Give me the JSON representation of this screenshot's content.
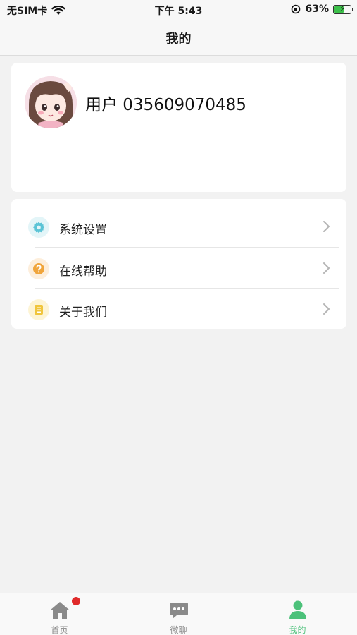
{
  "status_bar": {
    "carrier": "无SIM卡",
    "time": "下午 5:43",
    "battery_percent": "63%",
    "battery_level": 0.63
  },
  "header": {
    "title": "我的"
  },
  "profile": {
    "username": "用户 035609070485"
  },
  "menu": [
    {
      "label": "系统设置",
      "icon": "gear-icon",
      "color": "#5bc4d6",
      "bg": "#e3f5f8"
    },
    {
      "label": "在线帮助",
      "icon": "question-icon",
      "color": "#f0a53c",
      "bg": "#fdeedb"
    },
    {
      "label": "关于我们",
      "icon": "document-icon",
      "color": "#f0c53c",
      "bg": "#fdf4d4"
    }
  ],
  "tabs": [
    {
      "label": "首页",
      "icon": "home-icon",
      "active": false,
      "has_badge": true
    },
    {
      "label": "微聊",
      "icon": "chat-icon",
      "active": false,
      "has_badge": false
    },
    {
      "label": "我的",
      "icon": "person-icon",
      "active": true,
      "has_badge": false
    }
  ],
  "colors": {
    "accent": "#4cc17a",
    "badge": "#e02a2a",
    "background": "#f2f2f2"
  }
}
